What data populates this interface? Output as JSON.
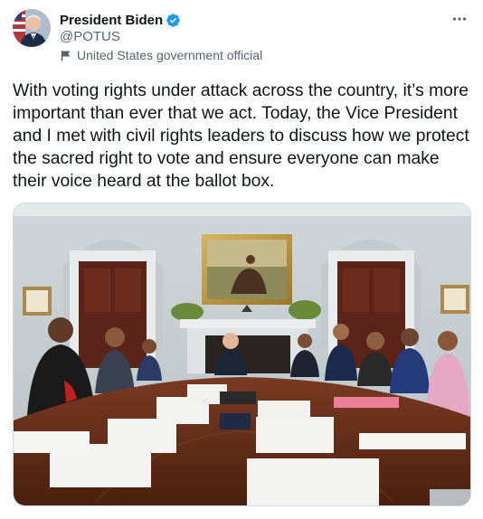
{
  "author": {
    "display_name": "President Biden",
    "handle": "@POTUS",
    "verified": true,
    "affiliation": "United States government official",
    "avatar_icon": "avatar-photo"
  },
  "tweet": {
    "text": "With voting rights under attack across the country, it’s more important than ever that we act. Today, the Vice President and I met with civil rights leaders to discuss how we protect the sacred right to vote and ensure everyone can make their voice heard at the ballot box."
  },
  "icons": {
    "verified": "verified-badge-icon",
    "affiliation": "flag-icon",
    "more": "more-options-icon"
  },
  "colors": {
    "verified_blue": "#1d9bf0",
    "secondary_text": "#536471",
    "primary_text": "#0f1419"
  }
}
